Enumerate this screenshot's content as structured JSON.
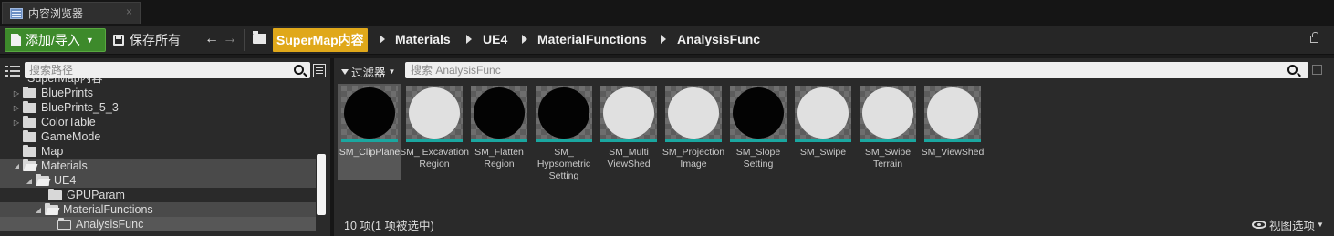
{
  "tab": {
    "title": "内容浏览器",
    "close": "×"
  },
  "toolbar": {
    "add_import_label": "添加/导入",
    "save_all_label": "保存所有",
    "back": "🡐",
    "forward": "🡒",
    "breadcrumbs": [
      "SuperMap内容",
      "Materials",
      "UE4",
      "MaterialFunctions",
      "AnalysisFunc"
    ]
  },
  "left_panel": {
    "search_placeholder": "搜索路径",
    "tree": [
      {
        "label": "SuperMap内容",
        "cut": true
      },
      {
        "label": "BluePrints",
        "exp": "▷"
      },
      {
        "label": "BluePrints_5_3",
        "exp": "▷"
      },
      {
        "label": "ColorTable",
        "exp": "▷"
      },
      {
        "label": "GameMode",
        "exp": ""
      },
      {
        "label": "Map",
        "exp": ""
      },
      {
        "label": "Materials",
        "exp": "◢",
        "open": true,
        "hl": true
      },
      {
        "label": "UE4",
        "exp": "◢",
        "open": true,
        "hl": true
      },
      {
        "label": "GPUParam",
        "exp": ""
      },
      {
        "label": "MaterialFunctions",
        "exp": "◢",
        "open": true,
        "hl": true
      },
      {
        "label": "AnalysisFunc",
        "exp": "",
        "outline": true,
        "sel": true
      }
    ]
  },
  "right_panel": {
    "filter_label": "过滤器",
    "search_placeholder": "搜索 AnalysisFunc",
    "assets": [
      {
        "name": "SM_ClipPlane",
        "ball": "black",
        "selected": true
      },
      {
        "name": "SM_ Excavation Region",
        "ball": "white"
      },
      {
        "name": "SM_Flatten Region",
        "ball": "black"
      },
      {
        "name": "SM_ Hypsometric Setting",
        "ball": "black"
      },
      {
        "name": "SM_Multi ViewShed",
        "ball": "white"
      },
      {
        "name": "SM_Projection Image",
        "ball": "white"
      },
      {
        "name": "SM_Slope Setting",
        "ball": "black"
      },
      {
        "name": "SM_Swipe",
        "ball": "white"
      },
      {
        "name": "SM_Swipe Terrain",
        "ball": "white"
      },
      {
        "name": "SM_ViewShed",
        "ball": "white"
      }
    ],
    "status": "10 项(1 项被选中)",
    "view_options": "视图选项"
  },
  "colors": {
    "add_button": "#3d8a2b",
    "breadcrumb_root": "#e0a81a",
    "thumb_border": "#1aa7a0"
  }
}
